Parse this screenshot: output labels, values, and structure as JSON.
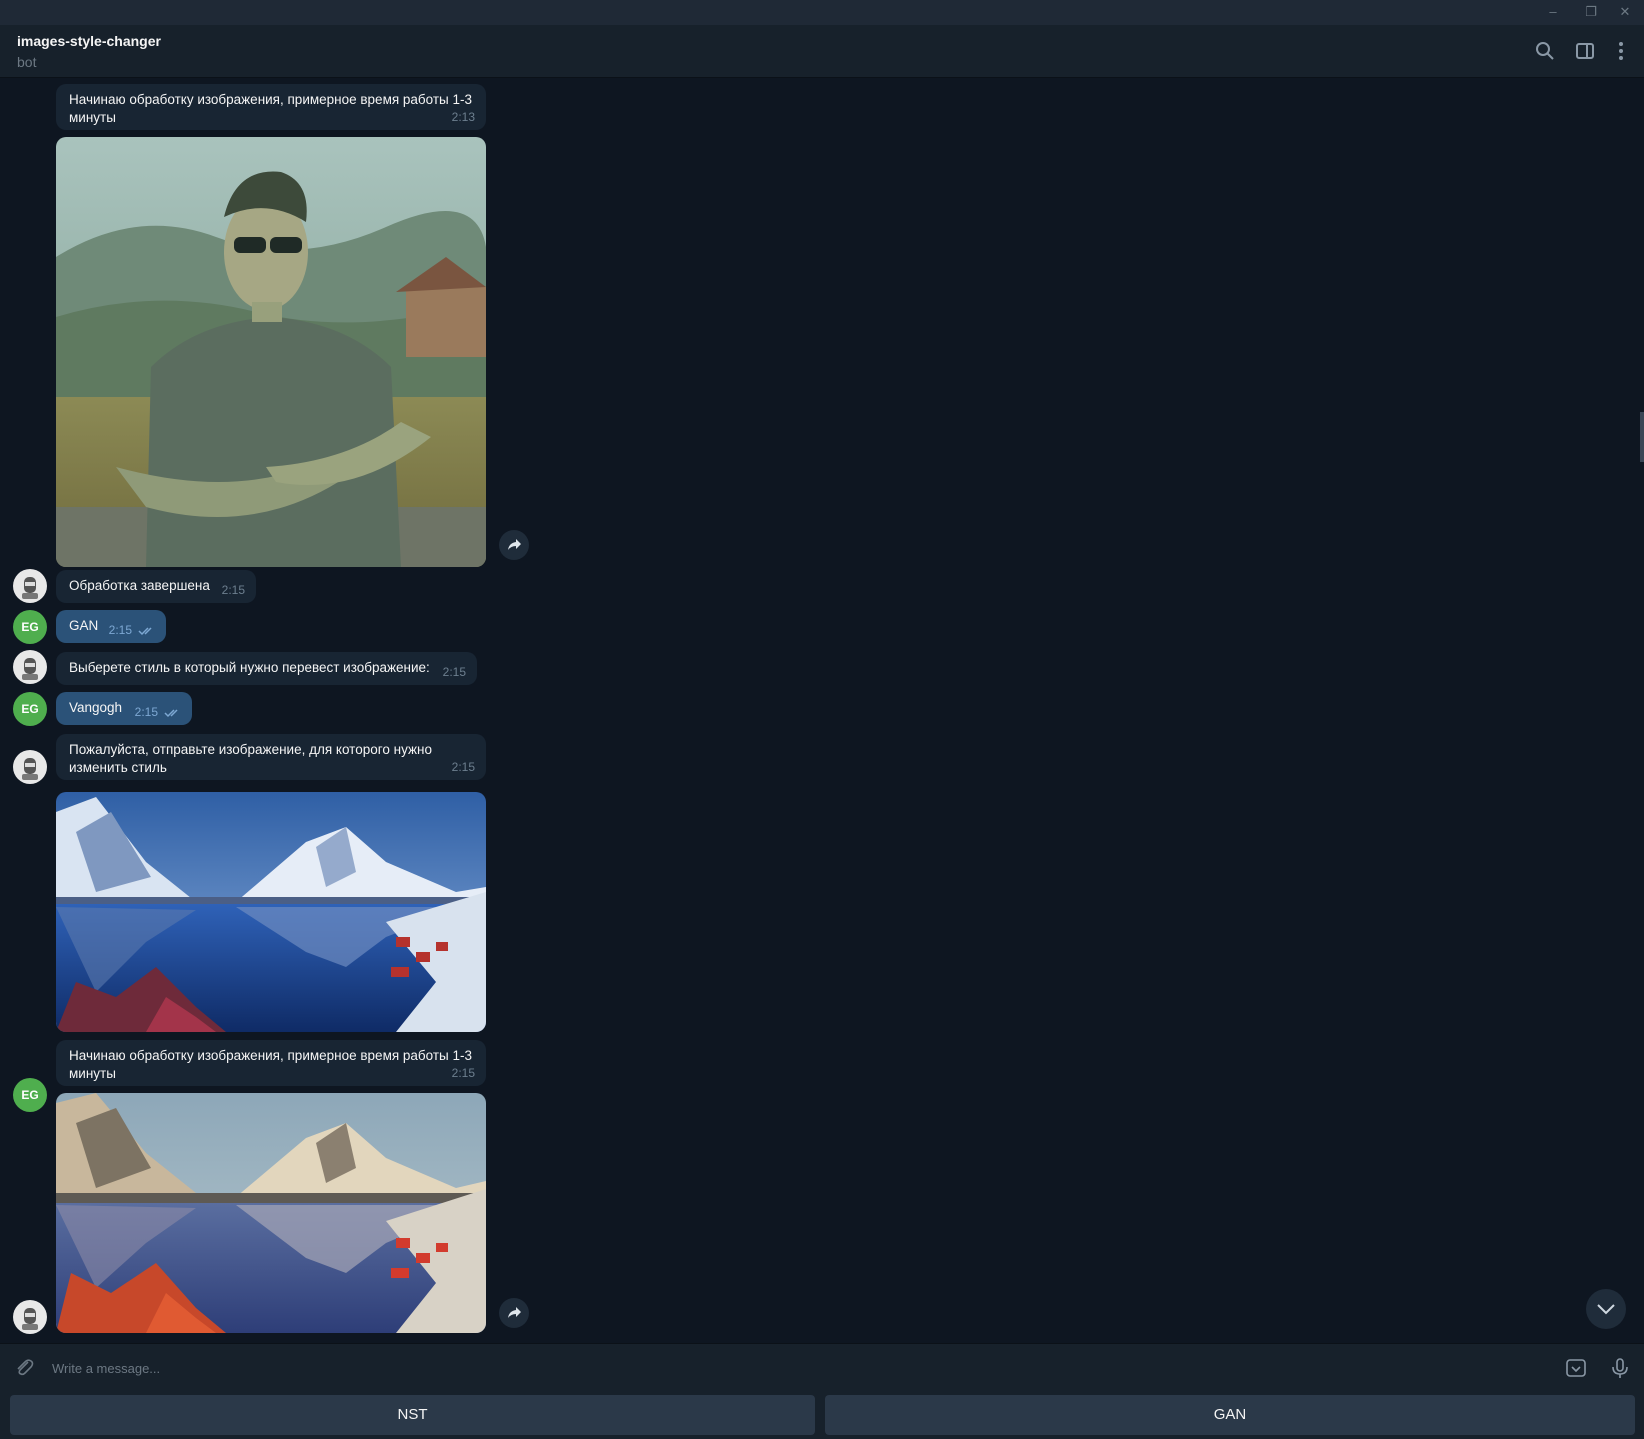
{
  "window": {
    "minimize_glyph": "–",
    "restore_glyph": "❐",
    "close_glyph": "✕"
  },
  "header": {
    "title": "images-style-changer",
    "subtitle": "bot",
    "icons": [
      "search-icon",
      "sidebar-toggle-icon",
      "more-vertical-icon"
    ]
  },
  "messages": [
    {
      "sender": "bot",
      "text": "Начинаю обработку изображения, примерное время работы 1-3 минуты",
      "time": "2:13"
    },
    {
      "sender": "bot",
      "type": "photo",
      "description": "stylized portrait result"
    },
    {
      "sender": "bot",
      "text": "Обработка завершена",
      "time": "2:15"
    },
    {
      "sender": "user",
      "avatar": "EG",
      "text": "GAN",
      "time": "2:15",
      "read": true
    },
    {
      "sender": "bot",
      "text": "Выберете стиль в который нужно перевест изображение:",
      "time": "2:15"
    },
    {
      "sender": "user",
      "avatar": "EG",
      "text": "Vangogh",
      "time": "2:15",
      "read": true
    },
    {
      "sender": "bot",
      "text": "Пожалуйста, отправьте изображение, для которого нужно изменить стиль",
      "time": "2:15"
    },
    {
      "sender": "user",
      "avatar": "EG",
      "type": "photo",
      "description": "fjord landscape"
    },
    {
      "sender": "bot",
      "text": "Начинаю обработку изображения, примерное время работы 1-3 минуты",
      "time": "2:15"
    },
    {
      "sender": "bot",
      "type": "photo",
      "description": "stylized fjord result"
    }
  ],
  "composer": {
    "placeholder": "Write a message..."
  },
  "keyboard": {
    "buttons": [
      "NST",
      "GAN"
    ]
  },
  "colors": {
    "background": "#0e1621",
    "header": "#17212b",
    "incoming_bubble": "#182533",
    "outgoing_bubble": "#2b5278",
    "user_avatar": "#4fae4e",
    "keyboard_button": "#2b3949"
  }
}
